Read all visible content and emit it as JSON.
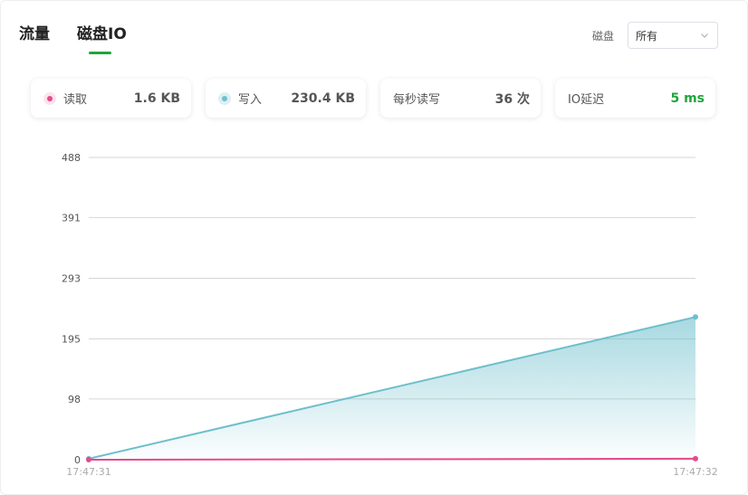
{
  "tabs": [
    {
      "label": "流量",
      "active": false
    },
    {
      "label": "磁盘IO",
      "active": true
    }
  ],
  "disk_select": {
    "label": "磁盘",
    "value": "所有"
  },
  "stats": [
    {
      "label": "读取",
      "value": "1.6 KB",
      "icon": "pink-dot-icon"
    },
    {
      "label": "写入",
      "value": "230.4 KB",
      "icon": "teal-dot-icon"
    },
    {
      "label": "每秒读写",
      "value": "36 次"
    },
    {
      "label": "IO延迟",
      "value": "5 ms"
    }
  ],
  "colors": {
    "accent": "#20a53a",
    "read": "#e64a8b",
    "write": "#6dbfcc"
  },
  "chart_data": {
    "type": "area",
    "x": [
      "17:47:31",
      "17:47:32"
    ],
    "y_ticks": [
      "0",
      "98",
      "195",
      "293",
      "391",
      "488"
    ],
    "ylim": [
      0,
      488
    ],
    "grid": true,
    "series": [
      {
        "values": [
          1.6,
          230.4
        ],
        "fill": true,
        "color": "#6dbfcc"
      },
      {
        "values": [
          0,
          1.6
        ],
        "fill": false,
        "color": "#e64a8b"
      }
    ]
  }
}
